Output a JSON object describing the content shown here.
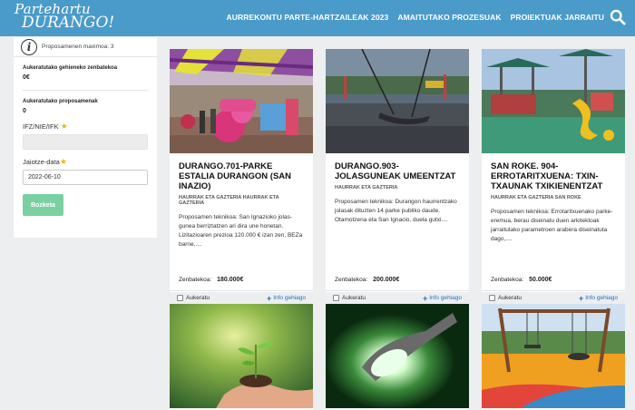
{
  "header": {
    "logo_line1": "Partehartu",
    "logo_line2": "DURANGO!",
    "nav": [
      "AURREKONTU PARTE-HARTZAILEAK 2023",
      "AMAITUTAKO PROZESUAK",
      "PROIEKTUAK JARRAITU"
    ]
  },
  "sidebar": {
    "max_proposals": "Proposamenen maximoa: 3",
    "max_amount_label": "Aukeratutako gehieneko zenbatekoa",
    "max_amount_value": "0€",
    "selected_label": "Aukeratutako proposamenak",
    "selected_value": "0",
    "id_label": "IFZ/NIE/IFK",
    "id_value": "",
    "birth_label": "Jaiotze-data",
    "birth_value": "2022-06-10",
    "submit_label": "Bozketa"
  },
  "cards": [
    {
      "title": "DURANGO.701-PARKE ESTALIA DURANGON (SAN INAZIO)",
      "tag": "HAURRAK ETA GAZTERIA HAURRAK ETA GAZTERIA",
      "desc": "Proposamen teknikoa: San Ignazioko jolas-gunea berriztatzen ari dira une honetan. Lizitazioaren prezioa 120.000 € izan zen, BEZa barne,....",
      "amount_label": "Zenbatekoa:",
      "amount": "180.000€",
      "select_label": "Aukeratu",
      "more_label": "Info gehiago"
    },
    {
      "title": "DURANGO.903- JOLASGUNEAK UMEENTZAT",
      "tag": "HAURRAK ETA GAZTERIA",
      "desc": "Proposamen teknikoa: Durangon haurrentzako jolasak dituzten 14 parke publiko daude. Otamotzena eta San Ignacio, duela gutxi....",
      "amount_label": "Zenbatekoa:",
      "amount": "200.000€",
      "select_label": "Aukeratu",
      "more_label": "Info gehiago"
    },
    {
      "title": "SAN ROKE. 904- ERROTARITXUENA: TXIN-TXAUNAK TXIKIENENTZAT",
      "tag": "HAURRAK ETA GAZTERIA SAN ROKE",
      "desc": "Proposamen teknikoa: Errotaritxuenako parke-eremua, berau diseinatu duen arkitektoak jarraitutako parametroen arabera diseinatuta dago,....",
      "amount_label": "Zenbatekoa:",
      "amount": "50.000€",
      "select_label": "Aukeratu",
      "more_label": "Info gehiago"
    }
  ],
  "icons": {
    "search": "search-icon",
    "info": "info-icon",
    "plus": "plus-icon"
  },
  "colors": {
    "header": "#4a9bc9",
    "button": "#7bd0a2",
    "link": "#2c6fb5",
    "star": "#f2b705"
  }
}
